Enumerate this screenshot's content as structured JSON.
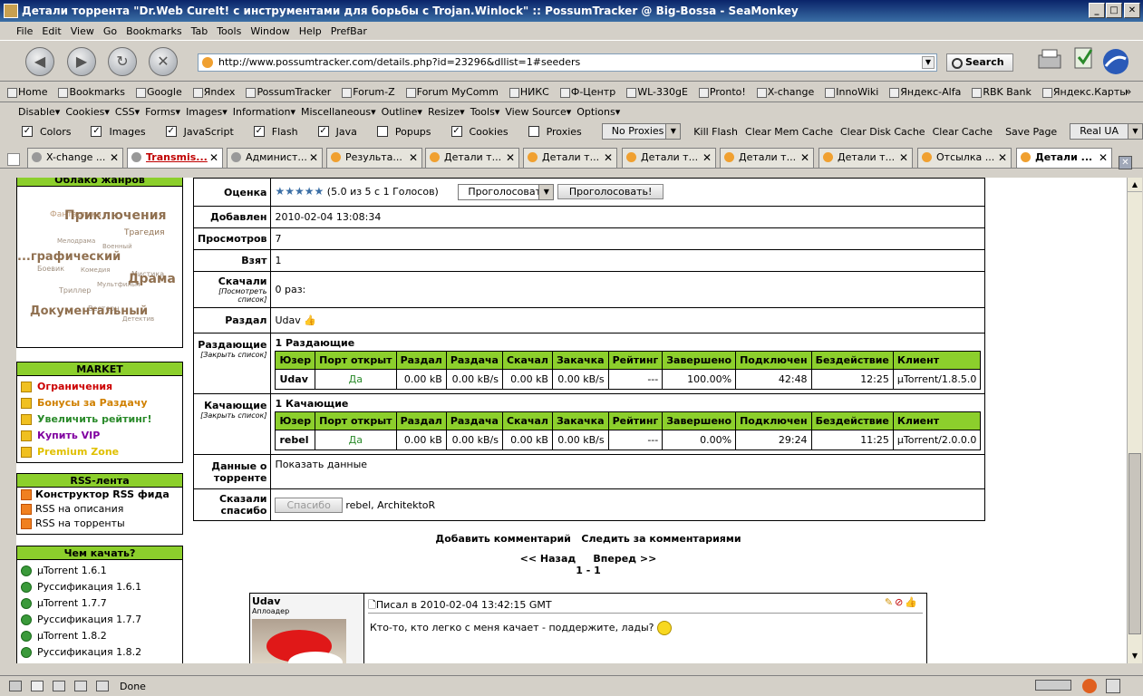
{
  "window": {
    "title": "Детали торрента \"Dr.Web CureIt! с инструментами для борьбы с Trojan.Winlock\" :: PossumTracker @ Big-Bossa - SeaMonkey",
    "min": "_",
    "max": "□",
    "close": "✕"
  },
  "menu": [
    "File",
    "Edit",
    "View",
    "Go",
    "Bookmarks",
    "Tab",
    "Tools",
    "Window",
    "Help",
    "PrefBar"
  ],
  "nav": {
    "url": "http://www.possumtracker.com/details.php?id=23296&dllist=1#seeders",
    "search_label": "Search"
  },
  "bookmarks": [
    "Home",
    "Bookmarks",
    "Google",
    "Яndex",
    "PossumTracker",
    "Forum-Z",
    "Forum MyComm",
    "НИКС",
    "Ф-Центр",
    "WL-330gE",
    "Pronto!",
    "X-change",
    "InnoWiki",
    "Яндекс-Alfa",
    "RBK Bank",
    "Яндекс.Карты"
  ],
  "webdev_menus": [
    "Disable▾",
    "Cookies▾",
    "CSS▾",
    "Forms▾",
    "Images▾",
    "Information▾",
    "Miscellaneous▾",
    "Outline▾",
    "Resize▾",
    "Tools▾",
    "View Source▾",
    "Options▾"
  ],
  "prefbar": {
    "checks": [
      "Colors",
      "Images",
      "JavaScript",
      "Flash",
      "Java",
      "Popups",
      "Cookies",
      "Proxies"
    ],
    "checked": [
      true,
      true,
      true,
      true,
      true,
      false,
      true,
      false
    ],
    "proxy_select": "No Proxies",
    "buttons": [
      "Kill Flash",
      "Clear Mem Cache",
      "Clear Disk Cache",
      "Clear Cache",
      "Save Page"
    ],
    "ua_select": "Real UA"
  },
  "tabs": [
    "X-change ...",
    "Transmis...",
    "Админист...",
    "Результа...",
    "Детали т...",
    "Детали т...",
    "Детали т...",
    "Детали т...",
    "Детали т...",
    "Отсылка ...",
    "Детали ..."
  ],
  "sidebar": {
    "tags_header": "Облако жанров",
    "tags": [
      "Фантастика",
      "Приключения",
      "Трагедия",
      "Мелодрама",
      "Военный",
      "...графический",
      "Боевик",
      "Комедия",
      "Мистика",
      "Драма",
      "Мультфильм",
      "Триллер",
      "Вестерн",
      "Документальный",
      "Детектив"
    ],
    "market_header": "MARKET",
    "market": [
      {
        "label": "Ограничения",
        "color": "#cc0000"
      },
      {
        "label": "Бонусы за Раздачу",
        "color": "#d08000"
      },
      {
        "label": "Увеличить рейтинг!",
        "color": "#2a8a2a"
      },
      {
        "label": "Купить VIP",
        "color": "#8000a0"
      },
      {
        "label": "Premium Zone",
        "color": "#e0c000"
      }
    ],
    "rss_header": "RSS-лента",
    "rss": [
      "Конструктор RSS фида",
      "RSS на описания",
      "RSS на торренты"
    ],
    "clients_header": "Чем качать?",
    "clients": [
      "µTorrent 1.6.1",
      "Руссификация 1.6.1",
      "µTorrent 1.7.7",
      "Руссификация 1.7.7",
      "µTorrent 1.8.2",
      "Руссификация 1.8.2"
    ]
  },
  "details": {
    "rating_label": "Оценка",
    "rating_stars": "★★★★★",
    "rating_text": "(5.0 из 5 с 1 Голосов)",
    "vote_select": "Проголосовать",
    "vote_button": "Проголосовать!",
    "added_label": "Добавлен",
    "added": "2010-02-04 13:08:34",
    "views_label": "Просмотров",
    "views": "7",
    "taken_label": "Взят",
    "taken": "1",
    "downloaded_label": "Скачали",
    "downloaded_sub": "[Посмотреть список]",
    "downloaded": "0 раз:",
    "uploader_label": "Раздал",
    "uploader": "Udav",
    "seeders_label": "Раздающие",
    "seeders_sub": "[Закрыть список]",
    "seeders_title": "1 Раздающие",
    "leechers_label": "Качающие",
    "leechers_sub": "[Закрыть список]",
    "leechers_title": "1 Качающие",
    "peer_columns": [
      "Юзер",
      "Порт открыт",
      "Раздал",
      "Раздача",
      "Скачал",
      "Закачка",
      "Рейтинг",
      "Завершено",
      "Подключен",
      "Бездействие",
      "Клиент"
    ],
    "seeders": [
      [
        "Udav",
        "Да",
        "0.00 kB",
        "0.00 kB/s",
        "0.00 kB",
        "0.00 kB/s",
        "---",
        "100.00%",
        "42:48",
        "12:25",
        "µTorrent/1.8.5.0"
      ]
    ],
    "leechers": [
      [
        "rebel",
        "Да",
        "0.00 kB",
        "0.00 kB/s",
        "0.00 kB",
        "0.00 kB/s",
        "---",
        "0.00%",
        "29:24",
        "11:25",
        "µTorrent/2.0.0.0"
      ]
    ],
    "data_label": "Данные о торренте",
    "data_link": "Показать данные",
    "thanks_label": "Сказали спасибо",
    "thanks_button": "Спасибо",
    "thanks_users": "rebel, ArchitektoR"
  },
  "comments": {
    "add": "Добавить комментарий",
    "follow": "Следить за комментариями",
    "prev": "<< Назад",
    "next": "Вперед >>",
    "range": "1 - 1",
    "author": "Udav",
    "role": "Аплоадер",
    "posted": "Писал в 2010-02-04 13:42:15 GMT",
    "text": "Кто-то, кто легко с меня качает - поддержите, лады?"
  },
  "status": {
    "text": "Done"
  }
}
